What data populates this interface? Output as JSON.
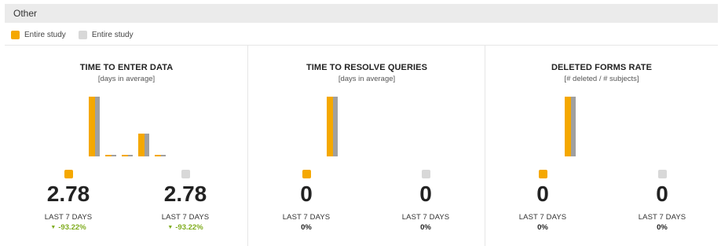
{
  "section": {
    "title": "Other"
  },
  "legend": [
    {
      "label": "Entire study",
      "color": "#f5a800"
    },
    {
      "label": "Entire study",
      "color": "#d8d8d8"
    }
  ],
  "colors": {
    "primary": "#f5a800",
    "secondary": "#a0a0a0",
    "legend_secondary": "#d8d8d8",
    "negative_change": "#7fac1e"
  },
  "panels": [
    {
      "title": "TIME TO ENTER DATA",
      "subtitle": "[days in average]",
      "chart": {
        "bars": [
          {
            "primary": 1.0,
            "secondary": 1.0
          },
          {
            "primary": 0.02,
            "secondary": 0.02
          },
          {
            "primary": 0.03,
            "secondary": 0.03
          },
          {
            "primary": 0.38,
            "secondary": 0.38
          },
          {
            "primary": 0.02,
            "secondary": 0.02
          }
        ]
      },
      "metrics": [
        {
          "value": "2.78",
          "label": "LAST 7 DAYS",
          "change": "-93.22%",
          "change_direction": "down"
        },
        {
          "value": "2.78",
          "label": "LAST 7 DAYS",
          "change": "-93.22%",
          "change_direction": "down"
        }
      ]
    },
    {
      "title": "TIME TO RESOLVE QUERIES",
      "subtitle": "[days in average]",
      "chart": {
        "bars": [
          {
            "primary": 1.0,
            "secondary": 1.0
          }
        ]
      },
      "metrics": [
        {
          "value": "0",
          "label": "LAST 7 DAYS",
          "change": "0%",
          "change_direction": "none"
        },
        {
          "value": "0",
          "label": "LAST 7 DAYS",
          "change": "0%",
          "change_direction": "none"
        }
      ]
    },
    {
      "title": "DELETED FORMS RATE",
      "subtitle": "[# deleted / # subjects]",
      "chart": {
        "bars": [
          {
            "primary": 1.0,
            "secondary": 1.0
          }
        ]
      },
      "metrics": [
        {
          "value": "0",
          "label": "LAST 7 DAYS",
          "change": "0%",
          "change_direction": "none"
        },
        {
          "value": "0",
          "label": "LAST 7 DAYS",
          "change": "0%",
          "change_direction": "none"
        }
      ]
    }
  ]
}
